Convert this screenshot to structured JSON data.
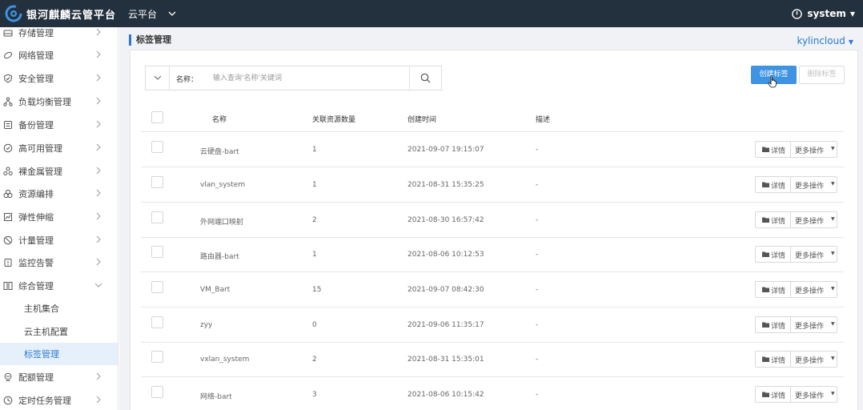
{
  "topbar": {
    "brand": "银河麒麟云管平台",
    "platform": "云平台",
    "user": "system"
  },
  "sidebar": {
    "items": [
      {
        "label": "存储管理",
        "icon": "storage-icon"
      },
      {
        "label": "网络管理",
        "icon": "network-icon"
      },
      {
        "label": "安全管理",
        "icon": "shield-icon"
      },
      {
        "label": "负载均衡管理",
        "icon": "load-balancer-icon"
      },
      {
        "label": "备份管理",
        "icon": "backup-icon"
      },
      {
        "label": "高可用管理",
        "icon": "high-availability-icon"
      },
      {
        "label": "裸金属管理",
        "icon": "bare-metal-icon"
      },
      {
        "label": "资源编排",
        "icon": "orchestration-icon"
      },
      {
        "label": "弹性伸缩",
        "icon": "auto-scaling-icon"
      },
      {
        "label": "计量管理",
        "icon": "metering-icon"
      },
      {
        "label": "监控告警",
        "icon": "alarm-icon"
      },
      {
        "label": "综合管理",
        "icon": "integrated-icon",
        "expanded": true
      }
    ],
    "sub_items": [
      {
        "label": "主机集合"
      },
      {
        "label": "云主机配置"
      },
      {
        "label": "标签管理",
        "active": true
      }
    ],
    "bottom_items": [
      {
        "label": "配额管理",
        "icon": "quota-icon"
      },
      {
        "label": "定时任务管理",
        "icon": "clock-icon"
      }
    ]
  },
  "main": {
    "page_title": "标签管理",
    "project": "kylincloud",
    "search": {
      "label": "名称：",
      "placeholder": "输入查询'名称'关键词"
    },
    "buttons": {
      "create": "创建标签",
      "delete": "删除标签"
    },
    "table": {
      "headers": [
        "名称",
        "关联资源数量",
        "创建时间",
        "描述"
      ],
      "rows": [
        {
          "name": "云硬盘-bart",
          "count": "1",
          "created": "2021-09-07 19:15:07",
          "desc": "-"
        },
        {
          "name": "vlan_system",
          "count": "1",
          "created": "2021-08-31 15:35:25",
          "desc": "-"
        },
        {
          "name": "外网端口映射",
          "count": "2",
          "created": "2021-08-30 16:57:42",
          "desc": "-"
        },
        {
          "name": "路由器-bart",
          "count": "1",
          "created": "2021-08-06 10:12:53",
          "desc": "-"
        },
        {
          "name": "VM_Bart",
          "count": "15",
          "created": "2021-09-07 08:42:30",
          "desc": "-"
        },
        {
          "name": "zyy",
          "count": "0",
          "created": "2021-09-06 11:35:17",
          "desc": "-"
        },
        {
          "name": "vxlan_system",
          "count": "2",
          "created": "2021-08-31 15:35:01",
          "desc": "-"
        },
        {
          "name": "网络-bart",
          "count": "3",
          "created": "2021-08-06 10:15:42",
          "desc": "-"
        }
      ],
      "row_actions": {
        "detail": "详情",
        "more": "更多操作"
      }
    }
  },
  "colors": {
    "topbar": "#23303d",
    "accent": "#2a7ad2",
    "primary_button": "#3e94e3",
    "active_bg": "#e6f0fb"
  }
}
